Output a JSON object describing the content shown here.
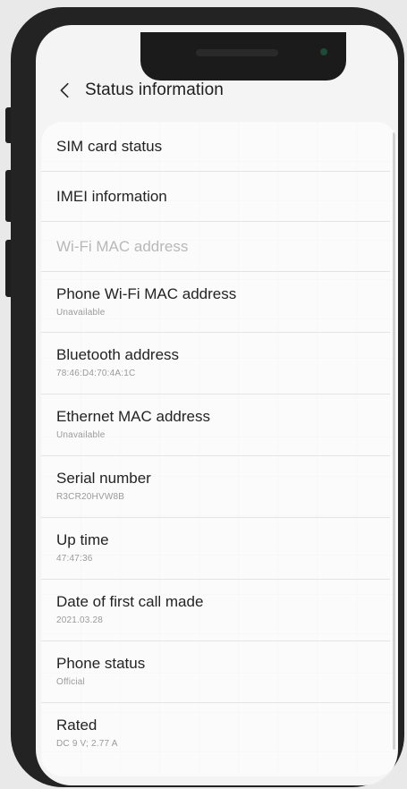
{
  "header": {
    "title": "Status information"
  },
  "icons": {
    "back": "chevron-left-icon"
  },
  "items": [
    {
      "label": "SIM card status",
      "value": ""
    },
    {
      "label": "IMEI information",
      "value": ""
    },
    {
      "label": "Wi-Fi MAC address",
      "value": "",
      "disabled": true
    },
    {
      "label": "Phone Wi-Fi MAC address",
      "value": "Unavailable"
    },
    {
      "label": "Bluetooth address",
      "value": "78:46:D4:70:4A:1C"
    },
    {
      "label": "Ethernet MAC address",
      "value": "Unavailable"
    },
    {
      "label": "Serial number",
      "value": "R3CR20HVW8B"
    },
    {
      "label": "Up time",
      "value": "47:47:36"
    },
    {
      "label": "Date of first call made",
      "value": "2021.03.28"
    },
    {
      "label": "Phone status",
      "value": "Official"
    },
    {
      "label": "Rated",
      "value": "DC 9 V; 2.77 A"
    }
  ],
  "colors": {
    "text_primary": "#232323",
    "text_secondary": "#9a9a9a",
    "text_disabled": "#b8b8b8",
    "phone_frame": "#232323",
    "screen_bg": "#f4f4f4"
  }
}
